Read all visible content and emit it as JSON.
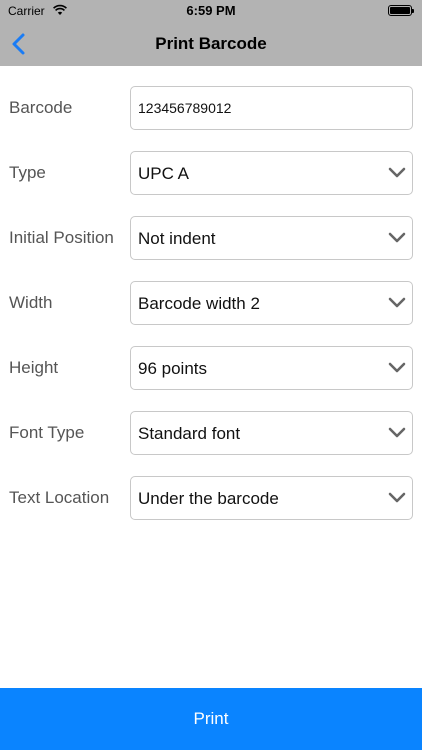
{
  "status_bar": {
    "carrier": "Carrier",
    "time": "6:59 PM",
    "wifi_icon": "wifi-icon",
    "battery_icon": "battery-icon"
  },
  "nav": {
    "title": "Print Barcode",
    "back_icon": "chevron-left-icon",
    "accent": "#1a7cf5"
  },
  "form": [
    {
      "label": "Barcode",
      "value": "123456789012",
      "kind": "text"
    },
    {
      "label": "Type",
      "value": "UPC A",
      "kind": "select"
    },
    {
      "label": "Initial Position",
      "value": "Not indent",
      "kind": "select"
    },
    {
      "label": "Width",
      "value": "Barcode width 2",
      "kind": "select"
    },
    {
      "label": "Height",
      "value": "96 points",
      "kind": "select"
    },
    {
      "label": "Font Type",
      "value": "Standard font",
      "kind": "select"
    },
    {
      "label": "Text Location",
      "value": "Under the barcode",
      "kind": "select"
    }
  ],
  "print_button": {
    "label": "Print",
    "color": "#0a84ff"
  }
}
